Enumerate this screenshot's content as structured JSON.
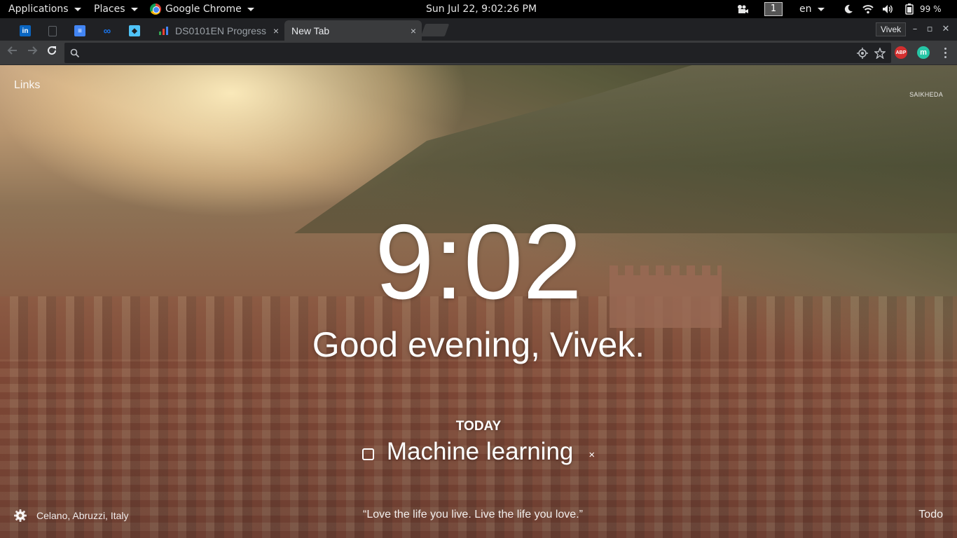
{
  "system_bar": {
    "applications": "Applications",
    "places": "Places",
    "app_name": "Google Chrome",
    "clock": "Sun Jul 22,  9:02:26 PM",
    "workspace": "1",
    "language": "en",
    "battery": "99 %"
  },
  "tabs": {
    "inactive_title": "DS0101EN Progress",
    "active_title": "New Tab",
    "close_symbol": "×",
    "pinned": [
      {
        "name": "linkedin",
        "glyph": "in",
        "color": "#0a66c2"
      },
      {
        "name": "document",
        "glyph": "",
        "color": "#5f6368"
      },
      {
        "name": "google-docs",
        "glyph": "≡",
        "color": "#4285f4"
      },
      {
        "name": "infinity",
        "glyph": "∞",
        "color": "#1a73e8"
      },
      {
        "name": "app",
        "glyph": "◆",
        "color": "#4fc3f7"
      }
    ]
  },
  "profile": "Vivek",
  "window_controls": {
    "minimize": "–",
    "maximize": "▫",
    "close": "✕"
  },
  "omnibox": {
    "value": "",
    "placeholder": ""
  },
  "extensions": {
    "adblock": "ABP",
    "momentum": "m"
  },
  "newtab": {
    "links": "Links",
    "photo_credit": "SAIKHEDA",
    "time": "9:02",
    "greeting": "Good evening, Vivek.",
    "focus_label": "TODAY",
    "focus_task": "Machine learning",
    "focus_delete": "×",
    "location": "Celano, Abruzzi, Italy",
    "quote": "“Love the life you live. Live the life you love.”",
    "todo": "Todo"
  },
  "colors": {
    "topbar": "#000000",
    "tabstrip": "#202124",
    "toolbar": "#3a3b3d",
    "adblock": "#d32f2f",
    "momentum": "#26c6a6"
  }
}
